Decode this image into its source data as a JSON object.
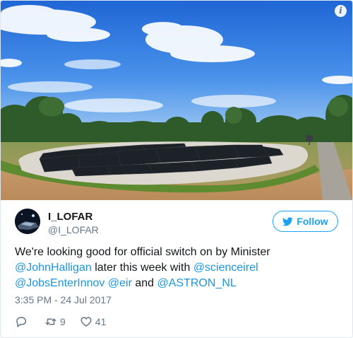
{
  "tweet": {
    "user": {
      "name": "I_LOFAR",
      "handle": "@I_LOFAR"
    },
    "follow_label": "Follow",
    "text_segments": [
      {
        "text": "We're looking good for official switch on by Minister ",
        "mention": false
      },
      {
        "text": "@JohnHalligan",
        "mention": true
      },
      {
        "text": " later this week with ",
        "mention": false
      },
      {
        "text": "@scienceirel",
        "mention": true
      },
      {
        "text": " ",
        "mention": false
      },
      {
        "text": "@JobsEnterInnov",
        "mention": true
      },
      {
        "text": " ",
        "mention": false
      },
      {
        "text": "@eir",
        "mention": true
      },
      {
        "text": " and ",
        "mention": false
      },
      {
        "text": "@ASTRON_NL",
        "mention": true
      }
    ],
    "timestamp": "3:35 PM - 24 Jul 2017",
    "stats": {
      "replies": "",
      "retweets": "9",
      "likes": "41"
    }
  },
  "icons": {
    "info": "info-icon",
    "bird": "twitter-bird-icon",
    "reply": "reply-icon",
    "retweet": "retweet-icon",
    "like": "heart-icon"
  },
  "colors": {
    "accent": "#1da1f2",
    "mention": "#1b95e0",
    "secondary_text": "#657786"
  }
}
